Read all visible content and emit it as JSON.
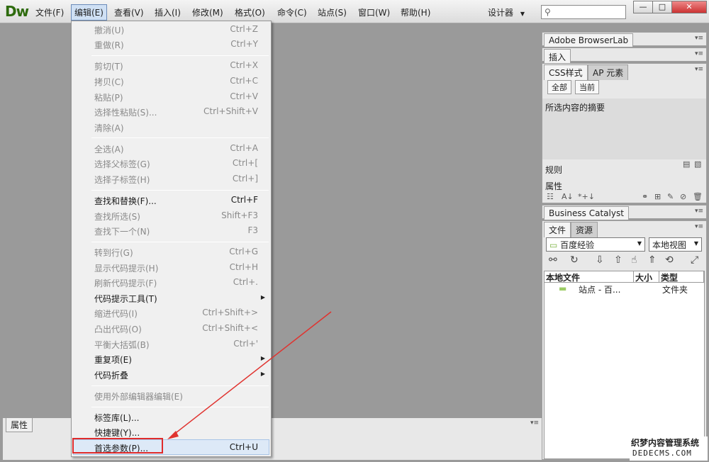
{
  "app": {
    "logo": "Dw"
  },
  "menubar": {
    "items": [
      {
        "label": "文件(F)"
      },
      {
        "label": "编辑(E)"
      },
      {
        "label": "查看(V)"
      },
      {
        "label": "插入(I)"
      },
      {
        "label": "修改(M)"
      },
      {
        "label": "格式(O)"
      },
      {
        "label": "命令(C)"
      },
      {
        "label": "站点(S)"
      },
      {
        "label": "窗口(W)"
      },
      {
        "label": "帮助(H)"
      }
    ],
    "workspace": "设计器",
    "window_buttons": [
      "—",
      "□",
      "✕"
    ]
  },
  "edit_menu": {
    "items": [
      {
        "label": "撤消(U)",
        "shortcut": "Ctrl+Z"
      },
      {
        "label": "重做(R)",
        "shortcut": "Ctrl+Y"
      },
      {
        "label": "剪切(T)",
        "shortcut": "Ctrl+X"
      },
      {
        "label": "拷贝(C)",
        "shortcut": "Ctrl+C"
      },
      {
        "label": "粘贴(P)",
        "shortcut": "Ctrl+V"
      },
      {
        "label": "选择性粘贴(S)...",
        "shortcut": "Ctrl+Shift+V"
      },
      {
        "label": "清除(A)",
        "shortcut": ""
      },
      {
        "label": "全选(A)",
        "shortcut": "Ctrl+A"
      },
      {
        "label": "选择父标签(G)",
        "shortcut": "Ctrl+["
      },
      {
        "label": "选择子标签(H)",
        "shortcut": "Ctrl+]"
      },
      {
        "label": "查找和替换(F)...",
        "shortcut": "Ctrl+F"
      },
      {
        "label": "查找所选(S)",
        "shortcut": "Shift+F3"
      },
      {
        "label": "查找下一个(N)",
        "shortcut": "F3"
      },
      {
        "label": "转到行(G)",
        "shortcut": "Ctrl+G"
      },
      {
        "label": "显示代码提示(H)",
        "shortcut": "Ctrl+H"
      },
      {
        "label": "刷新代码提示(F)",
        "shortcut": "Ctrl+."
      },
      {
        "label": "代码提示工具(T)",
        "shortcut": ""
      },
      {
        "label": "缩进代码(I)",
        "shortcut": "Ctrl+Shift+>"
      },
      {
        "label": "凸出代码(O)",
        "shortcut": "Ctrl+Shift+<"
      },
      {
        "label": "平衡大括弧(B)",
        "shortcut": "Ctrl+'"
      },
      {
        "label": "重复项(E)",
        "shortcut": ""
      },
      {
        "label": "代码折叠",
        "shortcut": ""
      },
      {
        "label": "使用外部编辑器编辑(E)",
        "shortcut": ""
      },
      {
        "label": "标签库(L)...",
        "shortcut": ""
      },
      {
        "label": "快捷键(Y)...",
        "shortcut": ""
      },
      {
        "label": "首选参数(P)...",
        "shortcut": "Ctrl+U"
      }
    ]
  },
  "panels": {
    "browserlab": "Adobe BrowserLab",
    "insert": "插入",
    "css_tab": "CSS样式",
    "ap_tab": "AP 元素",
    "seg_all": "全部",
    "seg_current": "当前",
    "selection_summary": "所选内容的摘要",
    "rules": "规则",
    "properties": "属性",
    "business_catalyst": "Business Catalyst",
    "files_tab": "文件",
    "assets_tab": "资源",
    "site_select": "百度经验",
    "view_select": "本地视图",
    "columns": [
      "本地文件",
      "大小",
      "类型"
    ],
    "row": {
      "name": "站点 - 百...",
      "type": "文件夹"
    }
  },
  "properties_bar": {
    "label": "属性"
  },
  "watermark": {
    "line1": "织梦内容管理系统",
    "line2": "DEDECMS.COM"
  }
}
